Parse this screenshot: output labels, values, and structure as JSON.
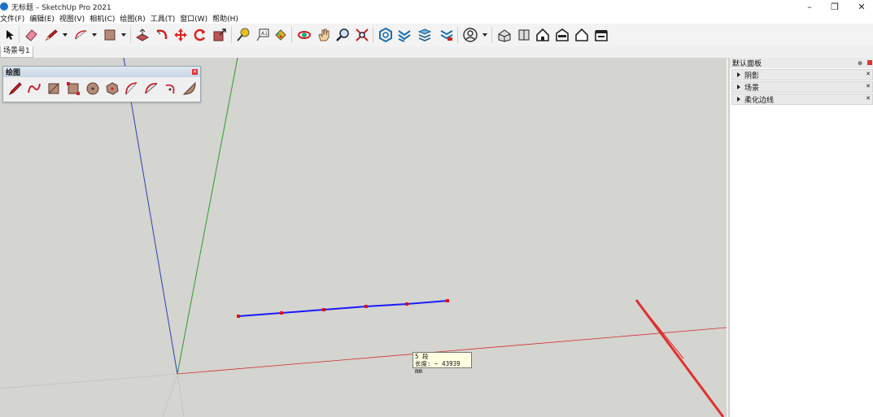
{
  "window": {
    "title": "无标题 – SketchUp Pro 2021",
    "minimize": "–",
    "restore": "❐",
    "close": "✕"
  },
  "menubar": {
    "items": [
      "文件(F)",
      "编辑(E)",
      "视图(V)",
      "相机(C)",
      "绘图(R)",
      "工具(T)",
      "窗口(W)",
      "帮助(H)"
    ]
  },
  "toolbar": {
    "tools": [
      "select",
      "eraser",
      "line",
      "arc",
      "rectangle",
      "push-pull",
      "follow-me",
      "move",
      "rotate",
      "scale",
      "tape-measure",
      "text",
      "paint-bucket",
      "orbit",
      "pan",
      "zoom",
      "zoom-extents",
      "3d-warehouse",
      "extension-warehouse",
      "layout",
      "components",
      "account",
      "iso-view",
      "top-view",
      "front-view",
      "right-view",
      "back-view",
      "left-view"
    ]
  },
  "scenes": {
    "tab_label": "场景号1"
  },
  "draw_palette": {
    "title": "绘图",
    "tools": [
      "line",
      "freehand",
      "rectangle",
      "rotated-rectangle",
      "circle",
      "polygon",
      "arc",
      "2pt-arc",
      "3pt-arc",
      "pie"
    ]
  },
  "tooltip": {
    "line1": "5 段",
    "line2": "长度: ~ 43939 mm"
  },
  "tray": {
    "title": "默认面板",
    "pin": "⊕",
    "sections": [
      {
        "label": "阴影"
      },
      {
        "label": "场景"
      },
      {
        "label": "柔化边线"
      }
    ]
  },
  "colors": {
    "x_axis": "#d03030",
    "y_axis": "#2f9a2f",
    "z_axis": "#3040b0",
    "line": "#1a1aff",
    "vertex": "#e01010",
    "viewport_bg": "#d4d4d0"
  }
}
